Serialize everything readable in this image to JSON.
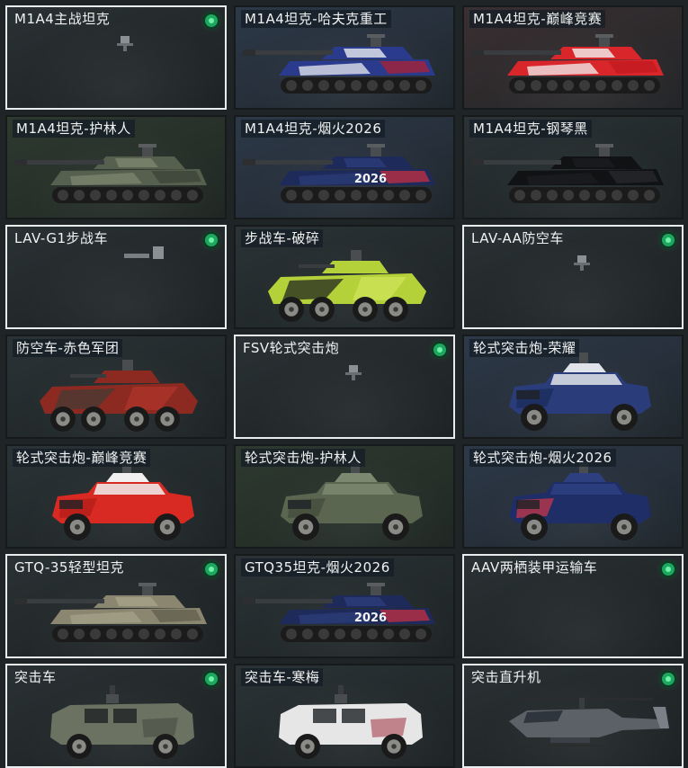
{
  "vehicles": [
    {
      "name": "M1A4主战坦克",
      "owned": true,
      "shape": "placeholder"
    },
    {
      "name": "M1A4坦克-哈夫克重工",
      "owned": false,
      "shape": "tank",
      "colors": [
        "#2a3a8c",
        "#e8ecf0",
        "#b8202c"
      ]
    },
    {
      "name": "M1A4坦克-巅峰竞赛",
      "owned": false,
      "shape": "tank",
      "colors": [
        "#d8262a",
        "#f2f2f2",
        "#c01a20"
      ]
    },
    {
      "name": "M1A4坦克-护林人",
      "owned": false,
      "shape": "tank",
      "colors": [
        "#55604e",
        "#7c8670",
        "#3b4236"
      ]
    },
    {
      "name": "M1A4坦克-烟火2026",
      "owned": false,
      "shape": "tank",
      "colors": [
        "#1d2a5a",
        "#2b3c78",
        "#d03040"
      ],
      "decal": "2026"
    },
    {
      "name": "M1A4坦克-钢琴黑",
      "owned": false,
      "shape": "tank",
      "colors": [
        "#111214",
        "#1c1d20",
        "#2a2b2e"
      ]
    },
    {
      "name": "LAV-G1步战车",
      "owned": true,
      "shape": "placeholder"
    },
    {
      "name": "步战车-破碎",
      "owned": false,
      "shape": "apc",
      "colors": [
        "#b5d13a",
        "#2b3220",
        "#d6e860"
      ]
    },
    {
      "name": "LAV-AA防空车",
      "owned": true,
      "shape": "placeholder"
    },
    {
      "name": "防空车-赤色军团",
      "owned": false,
      "shape": "apc",
      "colors": [
        "#8c2a22",
        "#4b3a34",
        "#b8382c"
      ]
    },
    {
      "name": "FSV轮式突击炮",
      "owned": true,
      "shape": "placeholder"
    },
    {
      "name": "轮式突击炮-荣耀",
      "owned": false,
      "shape": "truck",
      "colors": [
        "#2a3d7a",
        "#e0e4ea",
        "#1a2a58"
      ]
    },
    {
      "name": "轮式突击炮-巅峰竞赛",
      "owned": false,
      "shape": "truck",
      "colors": [
        "#d82a22",
        "#f0f0f0",
        "#b01c18"
      ]
    },
    {
      "name": "轮式突击炮-护林人",
      "owned": false,
      "shape": "truck",
      "colors": [
        "#5a6650",
        "#7d8870",
        "#414a3a"
      ]
    },
    {
      "name": "轮式突击炮-烟火2026",
      "owned": false,
      "shape": "truck",
      "colors": [
        "#1f2e66",
        "#2e3f80",
        "#d03848"
      ]
    },
    {
      "name": "GTQ-35轻型坦克",
      "owned": true,
      "shape": "tank",
      "colors": [
        "#8a8670",
        "#a6a28a",
        "#5e5c4c"
      ]
    },
    {
      "name": "GTQ35坦克-烟火2026",
      "owned": false,
      "shape": "tank",
      "colors": [
        "#1d2a5a",
        "#2c3d7a",
        "#d03040"
      ],
      "decal": "2026"
    },
    {
      "name": "AAV两栖装甲运输车",
      "owned": true,
      "shape": "none"
    },
    {
      "name": "突击车",
      "owned": true,
      "shape": "suv",
      "colors": [
        "#6b7262",
        "#8c9282",
        "#3f443a"
      ]
    },
    {
      "name": "突击车-寒梅",
      "owned": false,
      "shape": "suv",
      "colors": [
        "#e6e6e6",
        "#c8c8c8",
        "#9c2030"
      ]
    },
    {
      "name": "突击直升机",
      "owned": true,
      "shape": "heli",
      "colors": [
        "#5c6168",
        "#7a8088",
        "#3c4046"
      ]
    }
  ]
}
